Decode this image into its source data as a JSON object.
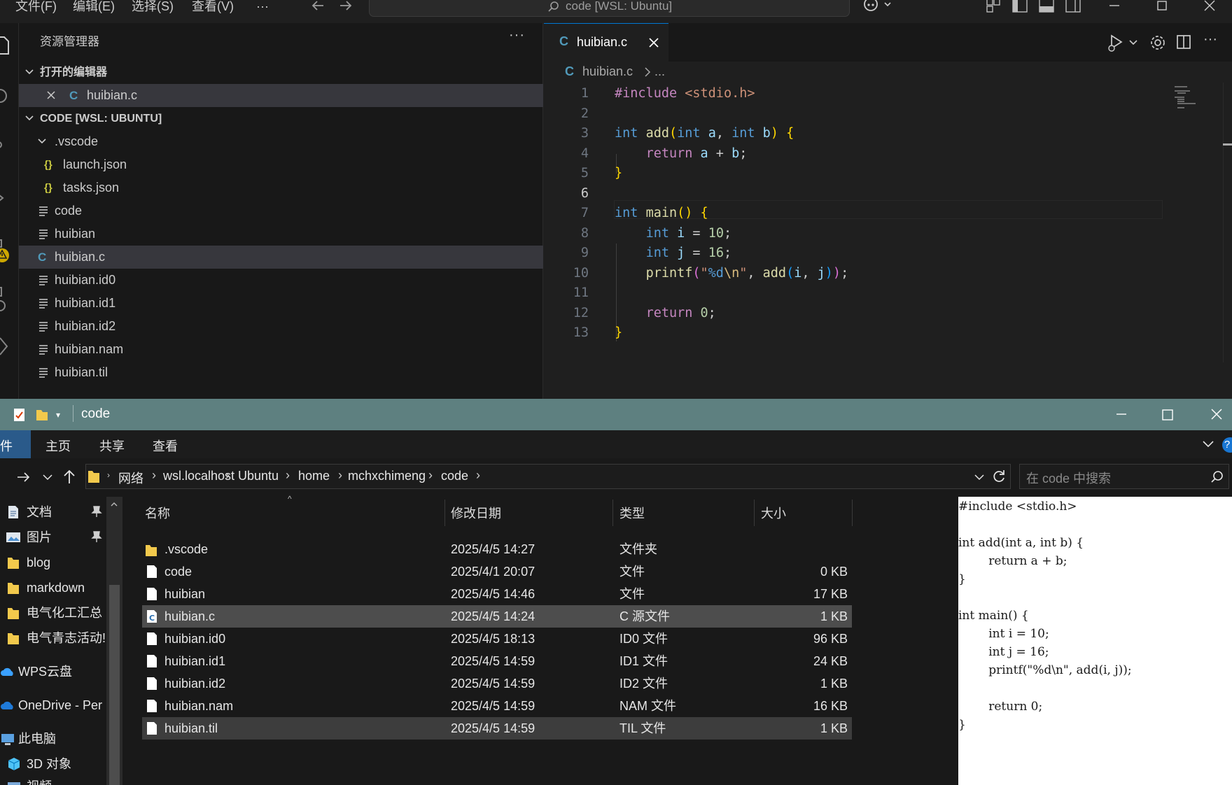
{
  "vscode": {
    "menu": [
      "文件(F)",
      "编辑(E)",
      "选择(S)",
      "查看(V)",
      "···"
    ],
    "command_center": "code [WSL: Ubuntu]",
    "explorer_title": "资源管理器",
    "open_editors_header": "打开的编辑器",
    "open_editor_file": "huibian.c",
    "workspace_header": "CODE [WSL: UBUNTU]",
    "tree": [
      {
        "label": ".vscode",
        "type": "folder"
      },
      {
        "label": "launch.json",
        "type": "json"
      },
      {
        "label": "tasks.json",
        "type": "json"
      },
      {
        "label": "code",
        "type": "file"
      },
      {
        "label": "huibian",
        "type": "file"
      },
      {
        "label": "huibian.c",
        "type": "c",
        "selected": true
      },
      {
        "label": "huibian.id0",
        "type": "file"
      },
      {
        "label": "huibian.id1",
        "type": "file"
      },
      {
        "label": "huibian.id2",
        "type": "file"
      },
      {
        "label": "huibian.nam",
        "type": "file"
      },
      {
        "label": "huibian.til",
        "type": "file"
      }
    ],
    "tab_label": "huibian.c",
    "breadcrumb_file": "huibian.c",
    "breadcrumb_more": "...",
    "c_icon": "C",
    "json_icon": "{}",
    "code_lines": [
      "#include <stdio.h>",
      "",
      "int add(int a, int b) {",
      "    return a + b;",
      "}",
      "",
      "int main() {",
      "    int i = 10;",
      "    int j = 16;",
      "    printf(\"%d\\n\", add(i, j));",
      "",
      "    return 0;",
      "}"
    ],
    "line_numbers": [
      "1",
      "2",
      "3",
      "4",
      "5",
      "6",
      "7",
      "8",
      "9",
      "10",
      "11",
      "12",
      "13"
    ],
    "current_line": 6
  },
  "explorer": {
    "title": "code",
    "ribbon_tabs": [
      "件",
      "主页",
      "共享",
      "查看"
    ],
    "path": [
      "网络",
      "wsl.localhost",
      "Ubuntu",
      "home",
      "mchxchimeng",
      "code"
    ],
    "search_placeholder": "在 code 中搜索",
    "nav_items": [
      "文档",
      "图片",
      "blog",
      "markdown",
      "电气化工汇总",
      "电气青志活动!",
      "WPS云盘",
      "OneDrive - Per",
      "此电脑",
      "3D 对象",
      "视频"
    ],
    "columns": [
      "名称",
      "修改日期",
      "类型",
      "大小"
    ],
    "files": [
      {
        "name": ".vscode",
        "date": "2025/4/5 14:27",
        "type": "文件夹",
        "size": ""
      },
      {
        "name": "code",
        "date": "2025/4/1 20:07",
        "type": "文件",
        "size": "0 KB"
      },
      {
        "name": "huibian",
        "date": "2025/4/5 14:46",
        "type": "文件",
        "size": "17 KB"
      },
      {
        "name": "huibian.c",
        "date": "2025/4/5 14:24",
        "type": "C 源文件",
        "size": "1 KB",
        "selected": true
      },
      {
        "name": "huibian.id0",
        "date": "2025/4/5 18:13",
        "type": "ID0 文件",
        "size": "96 KB"
      },
      {
        "name": "huibian.id1",
        "date": "2025/4/5 14:59",
        "type": "ID1 文件",
        "size": "24 KB"
      },
      {
        "name": "huibian.id2",
        "date": "2025/4/5 14:59",
        "type": "ID2 文件",
        "size": "1 KB"
      },
      {
        "name": "huibian.nam",
        "date": "2025/4/5 14:59",
        "type": "NAM 文件",
        "size": "16 KB"
      },
      {
        "name": "huibian.til",
        "date": "2025/4/5 14:59",
        "type": "TIL 文件",
        "size": "1 KB",
        "selected": true
      }
    ],
    "preview_lines": [
      "#include <stdio.h>",
      "",
      "int add(int a, int b) {",
      "        return a + b;",
      "}",
      "",
      "int main() {",
      "        int i = 10;",
      "        int j = 16;",
      "        printf(\"%d\\n\", add(i, j));",
      "",
      "        return 0;",
      "}"
    ],
    "help_badge": "?"
  }
}
